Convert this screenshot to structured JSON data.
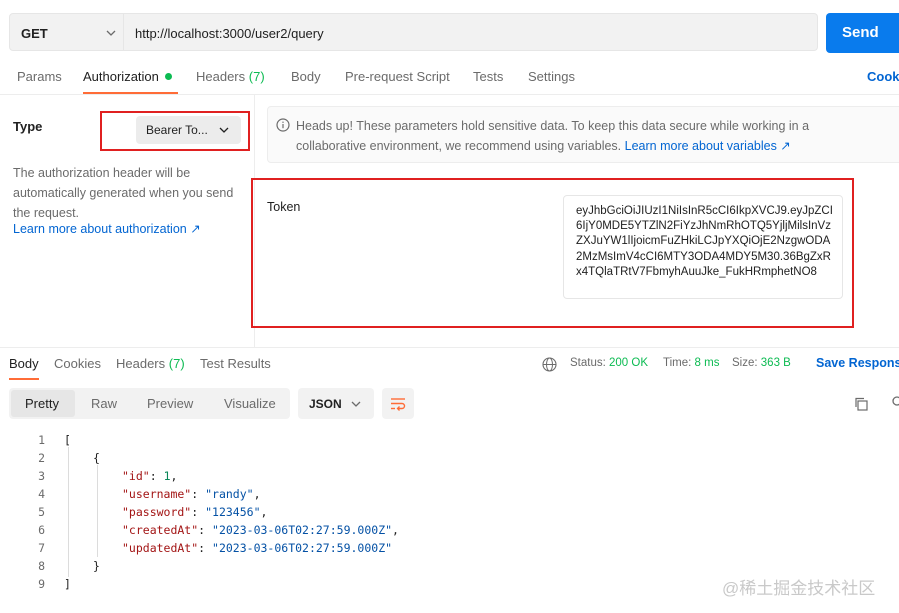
{
  "request": {
    "method": "GET",
    "url": "http://localhost:3000/user2/query",
    "send_label": "Send"
  },
  "request_tabs": {
    "params": "Params",
    "authorization": "Authorization",
    "headers": "Headers",
    "headers_count": "(7)",
    "body": "Body",
    "pre_request": "Pre-request Script",
    "tests": "Tests",
    "settings": "Settings",
    "cookies": "Cooki"
  },
  "auth": {
    "type_label": "Type",
    "type_value": "Bearer To...",
    "description": "The authorization header will be automatically generated when you send the request.",
    "learn_more": "Learn more about authorization ↗",
    "notice": "Heads up! These parameters hold sensitive data. To keep this data secure while working in a collaborative environment, we recommend using variables.",
    "notice_link": "Learn more about variables ↗",
    "token_label": "Token",
    "token_value": "eyJhbGciOiJIUzI1NiIsInR5cCI6IkpXVCJ9.eyJpZCI6IjY0MDE5YTZlN2FiYzJhNmRhOTQ5YjljMilsInVzZXJuYW1lIjoicmFuZHkiLCJpYXQiOjE2NzgwODA2MzMsImV4cCI6MTY3ODA4MDY5M30.36BgZxRx4TQlaTRtV7FbmyhAuuJke_FukHRmphetNO8"
  },
  "response_tabs": {
    "body": "Body",
    "cookies": "Cookies",
    "headers": "Headers",
    "headers_count": "(7)",
    "test_results": "Test Results"
  },
  "response_meta": {
    "status_label": "Status:",
    "status_value": "200 OK",
    "time_label": "Time:",
    "time_value": "8 ms",
    "size_label": "Size:",
    "size_value": "363 B",
    "save_response": "Save Response"
  },
  "view": {
    "pretty": "Pretty",
    "raw": "Raw",
    "preview": "Preview",
    "visualize": "Visualize",
    "format": "JSON"
  },
  "code": {
    "line_numbers": [
      "1",
      "2",
      "3",
      "4",
      "5",
      "6",
      "7",
      "8",
      "9"
    ],
    "open_bracket": "[",
    "open_brace": "{",
    "id_key": "\"id\"",
    "id_value": "1",
    "username_key": "\"username\"",
    "username_value": "\"randy\"",
    "password_key": "\"password\"",
    "password_value": "\"123456\"",
    "created_key": "\"createdAt\"",
    "created_value": "\"2023-03-06T02:27:59.000Z\"",
    "updated_key": "\"updatedAt\"",
    "updated_value": "\"2023-03-06T02:27:59.000Z\"",
    "close_brace": "}",
    "close_bracket": "]"
  },
  "watermark": "@稀土掘金技术社区",
  "icons": [
    "chevron-down-icon",
    "info-icon",
    "globe-icon",
    "wrap-icon",
    "copy-icon",
    "search-icon"
  ],
  "colors": {
    "accent": "#ff6c37",
    "send": "#097bed",
    "link": "#0265d2",
    "ok": "#0cbb52",
    "highlight": "#e02020"
  }
}
